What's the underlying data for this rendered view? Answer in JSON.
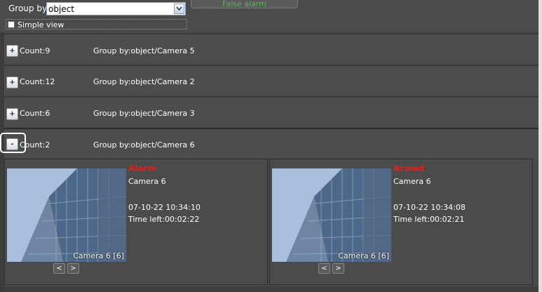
{
  "toolbar": {
    "group_by_label": "Group by:",
    "group_by_value": "object",
    "simple_view_label": "Simple view",
    "false_alarm_label": "False alarm"
  },
  "groups": [
    {
      "toggle": "+",
      "count": "Count:9",
      "group_by": "Group by:object/Camera 5"
    },
    {
      "toggle": "+",
      "count": "Count:12",
      "group_by": "Group by:object/Camera 2"
    },
    {
      "toggle": "+",
      "count": "Count:6",
      "group_by": "Group by:object/Camera 3"
    },
    {
      "toggle": "-",
      "count": "Count:2",
      "group_by": "Group by:object/Camera 6"
    }
  ],
  "alarms": [
    {
      "status": "Alarm",
      "camera": "Camera 6",
      "date": "07-10-22 10:34:10",
      "time_left": "Time left:00:02:22",
      "caption": "Camera 6 [6]",
      "prev": "<",
      "next": ">"
    },
    {
      "status": "Armed",
      "camera": "Camera 6",
      "date": "07-10-22 10:34:08",
      "time_left": "Time left:00:02:21",
      "caption": "Camera 6 [6]",
      "prev": "<",
      "next": ">"
    }
  ],
  "colors": {
    "status_red": "#e81c1c",
    "false_alarm_green": "#5fb35f"
  }
}
